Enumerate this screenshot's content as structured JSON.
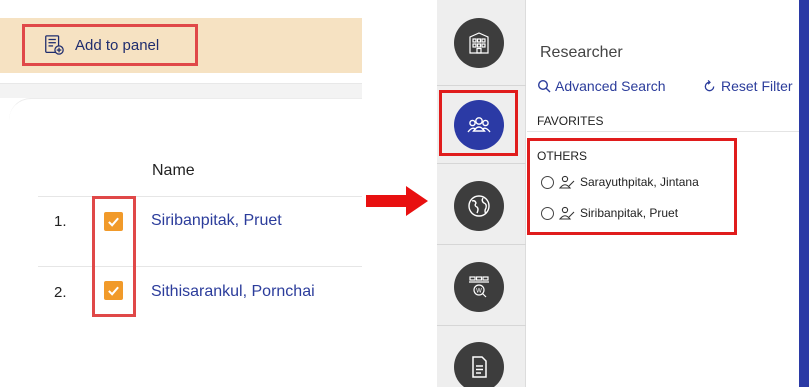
{
  "left": {
    "add_to_panel": "Add to panel",
    "column_name": "Name",
    "rows": [
      {
        "number": "1.",
        "name": "Siribanpitak, Pruet",
        "checked": true
      },
      {
        "number": "2.",
        "name": "Sithisarankul, Pornchai",
        "checked": true
      }
    ]
  },
  "right": {
    "nav_icons": [
      "building-icon",
      "people-icon",
      "globe-icon",
      "web-search-icon",
      "document-icon"
    ],
    "active_nav": "people-icon",
    "header": "Researcher",
    "advanced_search": "Advanced Search",
    "reset_filter": "Reset Filter",
    "favorites_label": "FAVORITES",
    "others_label": "OTHERS",
    "others": [
      "Sarayuthpitak, Jintana",
      "Siribanpitak, Pruet"
    ]
  },
  "colors": {
    "highlight": "#e01c1c",
    "toolbar_bg": "#f6e2c2",
    "checkbox": "#f19a2a",
    "link": "#2b3c9b",
    "active_nav": "#2b3aa5",
    "arrow": "#e81010"
  }
}
